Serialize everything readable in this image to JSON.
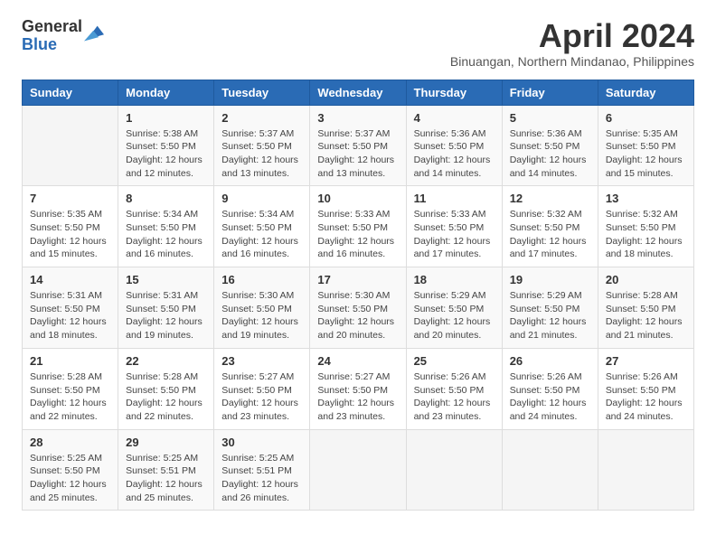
{
  "header": {
    "logo_general": "General",
    "logo_blue": "Blue",
    "month_title": "April 2024",
    "location": "Binuangan, Northern Mindanao, Philippines"
  },
  "weekdays": [
    "Sunday",
    "Monday",
    "Tuesday",
    "Wednesday",
    "Thursday",
    "Friday",
    "Saturday"
  ],
  "weeks": [
    [
      {
        "day": "",
        "sunrise": "",
        "sunset": "",
        "daylight": ""
      },
      {
        "day": "1",
        "sunrise": "Sunrise: 5:38 AM",
        "sunset": "Sunset: 5:50 PM",
        "daylight": "Daylight: 12 hours and 12 minutes."
      },
      {
        "day": "2",
        "sunrise": "Sunrise: 5:37 AM",
        "sunset": "Sunset: 5:50 PM",
        "daylight": "Daylight: 12 hours and 13 minutes."
      },
      {
        "day": "3",
        "sunrise": "Sunrise: 5:37 AM",
        "sunset": "Sunset: 5:50 PM",
        "daylight": "Daylight: 12 hours and 13 minutes."
      },
      {
        "day": "4",
        "sunrise": "Sunrise: 5:36 AM",
        "sunset": "Sunset: 5:50 PM",
        "daylight": "Daylight: 12 hours and 14 minutes."
      },
      {
        "day": "5",
        "sunrise": "Sunrise: 5:36 AM",
        "sunset": "Sunset: 5:50 PM",
        "daylight": "Daylight: 12 hours and 14 minutes."
      },
      {
        "day": "6",
        "sunrise": "Sunrise: 5:35 AM",
        "sunset": "Sunset: 5:50 PM",
        "daylight": "Daylight: 12 hours and 15 minutes."
      }
    ],
    [
      {
        "day": "7",
        "sunrise": "Sunrise: 5:35 AM",
        "sunset": "Sunset: 5:50 PM",
        "daylight": "Daylight: 12 hours and 15 minutes."
      },
      {
        "day": "8",
        "sunrise": "Sunrise: 5:34 AM",
        "sunset": "Sunset: 5:50 PM",
        "daylight": "Daylight: 12 hours and 16 minutes."
      },
      {
        "day": "9",
        "sunrise": "Sunrise: 5:34 AM",
        "sunset": "Sunset: 5:50 PM",
        "daylight": "Daylight: 12 hours and 16 minutes."
      },
      {
        "day": "10",
        "sunrise": "Sunrise: 5:33 AM",
        "sunset": "Sunset: 5:50 PM",
        "daylight": "Daylight: 12 hours and 16 minutes."
      },
      {
        "day": "11",
        "sunrise": "Sunrise: 5:33 AM",
        "sunset": "Sunset: 5:50 PM",
        "daylight": "Daylight: 12 hours and 17 minutes."
      },
      {
        "day": "12",
        "sunrise": "Sunrise: 5:32 AM",
        "sunset": "Sunset: 5:50 PM",
        "daylight": "Daylight: 12 hours and 17 minutes."
      },
      {
        "day": "13",
        "sunrise": "Sunrise: 5:32 AM",
        "sunset": "Sunset: 5:50 PM",
        "daylight": "Daylight: 12 hours and 18 minutes."
      }
    ],
    [
      {
        "day": "14",
        "sunrise": "Sunrise: 5:31 AM",
        "sunset": "Sunset: 5:50 PM",
        "daylight": "Daylight: 12 hours and 18 minutes."
      },
      {
        "day": "15",
        "sunrise": "Sunrise: 5:31 AM",
        "sunset": "Sunset: 5:50 PM",
        "daylight": "Daylight: 12 hours and 19 minutes."
      },
      {
        "day": "16",
        "sunrise": "Sunrise: 5:30 AM",
        "sunset": "Sunset: 5:50 PM",
        "daylight": "Daylight: 12 hours and 19 minutes."
      },
      {
        "day": "17",
        "sunrise": "Sunrise: 5:30 AM",
        "sunset": "Sunset: 5:50 PM",
        "daylight": "Daylight: 12 hours and 20 minutes."
      },
      {
        "day": "18",
        "sunrise": "Sunrise: 5:29 AM",
        "sunset": "Sunset: 5:50 PM",
        "daylight": "Daylight: 12 hours and 20 minutes."
      },
      {
        "day": "19",
        "sunrise": "Sunrise: 5:29 AM",
        "sunset": "Sunset: 5:50 PM",
        "daylight": "Daylight: 12 hours and 21 minutes."
      },
      {
        "day": "20",
        "sunrise": "Sunrise: 5:28 AM",
        "sunset": "Sunset: 5:50 PM",
        "daylight": "Daylight: 12 hours and 21 minutes."
      }
    ],
    [
      {
        "day": "21",
        "sunrise": "Sunrise: 5:28 AM",
        "sunset": "Sunset: 5:50 PM",
        "daylight": "Daylight: 12 hours and 22 minutes."
      },
      {
        "day": "22",
        "sunrise": "Sunrise: 5:28 AM",
        "sunset": "Sunset: 5:50 PM",
        "daylight": "Daylight: 12 hours and 22 minutes."
      },
      {
        "day": "23",
        "sunrise": "Sunrise: 5:27 AM",
        "sunset": "Sunset: 5:50 PM",
        "daylight": "Daylight: 12 hours and 23 minutes."
      },
      {
        "day": "24",
        "sunrise": "Sunrise: 5:27 AM",
        "sunset": "Sunset: 5:50 PM",
        "daylight": "Daylight: 12 hours and 23 minutes."
      },
      {
        "day": "25",
        "sunrise": "Sunrise: 5:26 AM",
        "sunset": "Sunset: 5:50 PM",
        "daylight": "Daylight: 12 hours and 23 minutes."
      },
      {
        "day": "26",
        "sunrise": "Sunrise: 5:26 AM",
        "sunset": "Sunset: 5:50 PM",
        "daylight": "Daylight: 12 hours and 24 minutes."
      },
      {
        "day": "27",
        "sunrise": "Sunrise: 5:26 AM",
        "sunset": "Sunset: 5:50 PM",
        "daylight": "Daylight: 12 hours and 24 minutes."
      }
    ],
    [
      {
        "day": "28",
        "sunrise": "Sunrise: 5:25 AM",
        "sunset": "Sunset: 5:50 PM",
        "daylight": "Daylight: 12 hours and 25 minutes."
      },
      {
        "day": "29",
        "sunrise": "Sunrise: 5:25 AM",
        "sunset": "Sunset: 5:51 PM",
        "daylight": "Daylight: 12 hours and 25 minutes."
      },
      {
        "day": "30",
        "sunrise": "Sunrise: 5:25 AM",
        "sunset": "Sunset: 5:51 PM",
        "daylight": "Daylight: 12 hours and 26 minutes."
      },
      {
        "day": "",
        "sunrise": "",
        "sunset": "",
        "daylight": ""
      },
      {
        "day": "",
        "sunrise": "",
        "sunset": "",
        "daylight": ""
      },
      {
        "day": "",
        "sunrise": "",
        "sunset": "",
        "daylight": ""
      },
      {
        "day": "",
        "sunrise": "",
        "sunset": "",
        "daylight": ""
      }
    ]
  ]
}
